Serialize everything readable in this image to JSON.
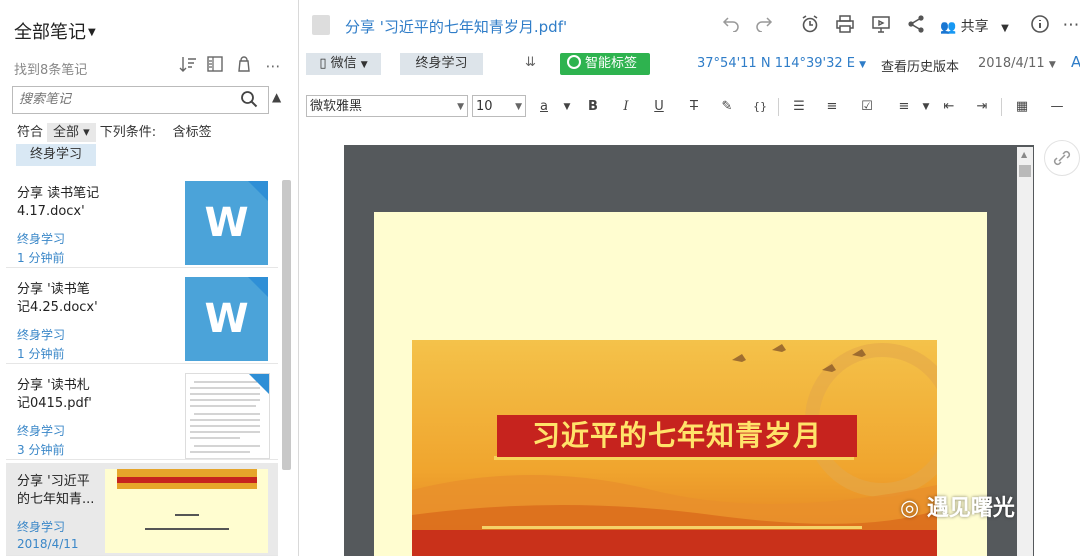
{
  "left_panel": {
    "title": "全部笔记",
    "count": "找到8条笔记",
    "search_placeholder": "搜索笔记",
    "filter": {
      "match_label": "符合",
      "match_value": "全部",
      "condition_label": "下列条件:",
      "condition_value": "含标签"
    },
    "tag_chip": "终身学习",
    "notes": [
      {
        "title": "分享 读书笔记4.17.docx'",
        "tag": "终身学习",
        "time": "1 分钟前",
        "thumb_type": "word"
      },
      {
        "title": "分享 '读书笔记4.25.docx'",
        "tag": "终身学习",
        "time": "1 分钟前",
        "thumb_type": "word"
      },
      {
        "title": "分享 '读书札记0415.pdf'",
        "tag": "终身学习",
        "time": "3 分钟前",
        "thumb_type": "pdf-text"
      },
      {
        "title": "分享 '习近平的七年知青...",
        "tag": "终身学习",
        "time": "2018/4/11",
        "thumb_type": "pdf-banner"
      }
    ]
  },
  "editor": {
    "doc_title": "分享 '习近平的七年知青岁月.pdf'",
    "share_label": "共享",
    "notebook_chip": "微信",
    "tag_chip": "终身学习",
    "smart_tag": "智能标签",
    "coords": "37°54'11 N  114°39'32 E",
    "history": "查看历史版本",
    "date": "2018/4/11",
    "font_family": "微软雅黑",
    "font_size": "10",
    "banner_title": "习近平的七年知青岁月"
  },
  "watermark": "遇见曙光",
  "colors": {
    "accent": "#2f7dc8",
    "smart_tag": "#2eb34f",
    "banner_red": "#c6231e",
    "page_bg": "#fffdd0"
  }
}
